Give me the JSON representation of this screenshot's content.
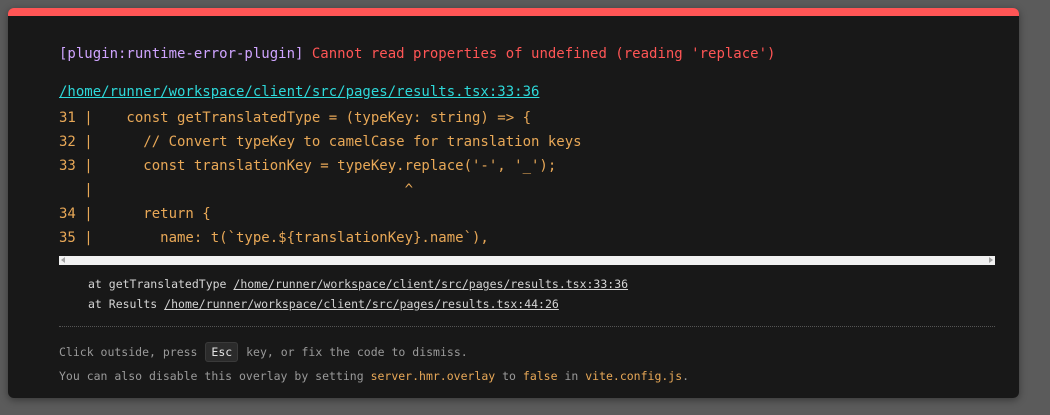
{
  "error": {
    "plugin": "[plugin:runtime-error-plugin]",
    "message": "Cannot read properties of undefined (reading 'replace')",
    "file": "/home/runner/workspace/client/src/pages/results.tsx:33:36"
  },
  "frame": {
    "lines": [
      "31 |    const getTranslatedType = (typeKey: string) => {",
      "32 |      // Convert typeKey to camelCase for translation keys",
      "33 |      const translationKey = typeKey.replace('-', '_');",
      "   |                                     ^",
      "34 |      return {",
      "35 |        name: t(`type.${translationKey}.name`),"
    ]
  },
  "stack": [
    {
      "at": "at getTranslatedType ",
      "loc": "/home/runner/workspace/client/src/pages/results.tsx:33:36"
    },
    {
      "at": "at Results ",
      "loc": "/home/runner/workspace/client/src/pages/results.tsx:44:26"
    }
  ],
  "tip": {
    "line1_before": "Click outside, press ",
    "line1_key": "Esc",
    "line1_after": " key, or fix the code to dismiss.",
    "line2_a": "You can also disable this overlay by setting ",
    "line2_code1": "server.hmr.overlay",
    "line2_b": " to ",
    "line2_code2": "false",
    "line2_c": " in ",
    "line2_code3": "vite.config.js",
    "line2_d": "."
  },
  "colors": {
    "accent": "#ff5555",
    "plugin": "#cfa4ff",
    "file_link": "#2dd9da",
    "code": "#e8a857"
  }
}
